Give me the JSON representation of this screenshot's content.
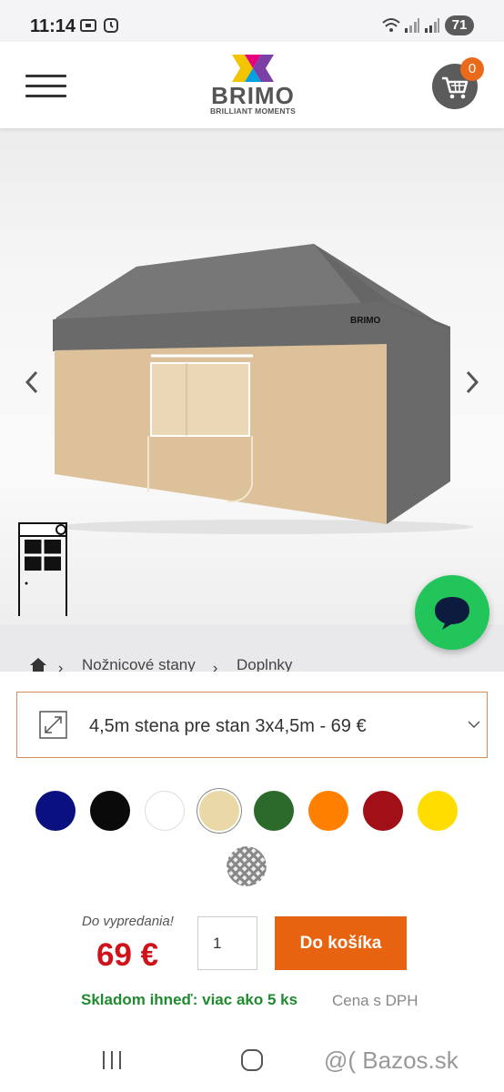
{
  "status_bar": {
    "time": "11:14",
    "battery": "71",
    "icons": [
      "screenshot-icon",
      "alarm-icon",
      "wifi-icon",
      "signal-icon",
      "signal-icon"
    ]
  },
  "header": {
    "brand": "BRIMO",
    "tagline": "BRILLIANT MOMENTS",
    "cart_count": "0",
    "icons": [
      "menu-icon",
      "cart-icon"
    ]
  },
  "gallery": {
    "icons": [
      "chevron-left-icon",
      "chevron-right-icon",
      "chat-icon"
    ],
    "thumbnail": "wall-with-window-icon"
  },
  "breadcrumb": {
    "items": [
      "Nožnicové stany",
      "Doplnky"
    ]
  },
  "variant": {
    "label": "4,5m stena pre stan 3x4,5m - 69 €"
  },
  "colors": {
    "swatches": [
      "#0a1080",
      "#0a0a0a",
      "#ffffff",
      "#ead9a6",
      "#2c6a2c",
      "#ff8000",
      "#a11016",
      "#ffdd00",
      "pattern-grey"
    ],
    "selected_index": 3
  },
  "purchase": {
    "promo": "Do vypredania!",
    "price": "69 €",
    "quantity": "1",
    "add_to_cart": "Do košíka",
    "stock": "Skladom ihneď: viac ako 5 ks",
    "vat_note": "Cena s DPH"
  },
  "watermark": "@( Bazos.sk",
  "colors_theme": {
    "accent": "#e8630f",
    "price": "#d0121b",
    "stock": "#1f8a2e",
    "chat": "#22c55a"
  }
}
